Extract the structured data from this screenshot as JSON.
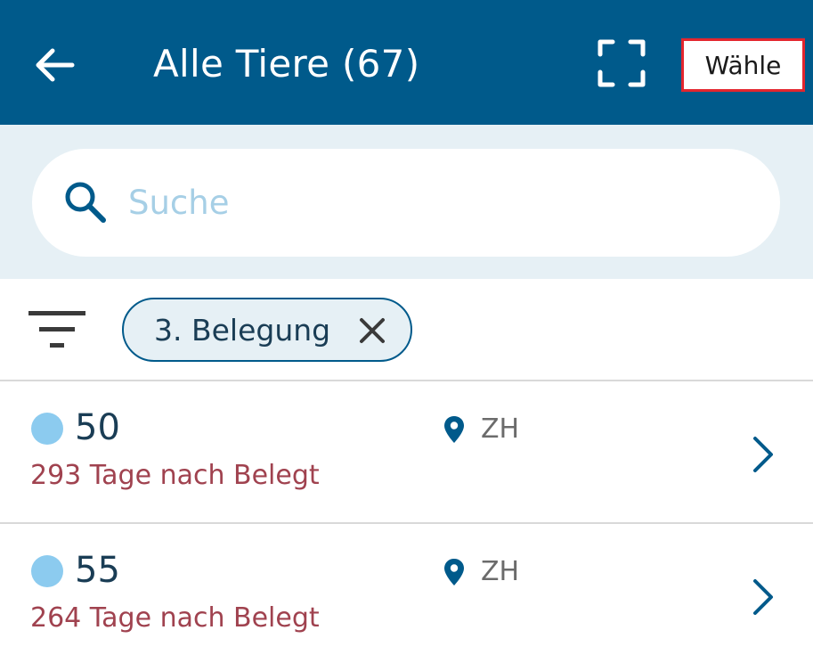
{
  "header": {
    "back_icon": "arrow-left-icon",
    "title": "Alle Tiere (67)",
    "scan_icon": "fullscreen-scan-icon",
    "select_label": "Wähle"
  },
  "search": {
    "placeholder": "Suche",
    "value": "",
    "icon": "search-icon"
  },
  "filters": {
    "filter_icon": "filter-icon",
    "chips": [
      {
        "label": "3. Belegung",
        "close_icon": "close-icon"
      }
    ]
  },
  "animals": [
    {
      "number": "50",
      "status_color": "#8ccbef",
      "days_label": "293 Tage nach Belegt",
      "location": "ZH"
    },
    {
      "number": "55",
      "status_color": "#8ccbef",
      "days_label": "264 Tage nach Belegt",
      "location": "ZH"
    }
  ],
  "colors": {
    "primary": "#005a8b",
    "search_bg": "#e6f0f5",
    "highlight_border": "#e3262e",
    "days_text": "#a0424f",
    "status_dot": "#8ccbef"
  }
}
